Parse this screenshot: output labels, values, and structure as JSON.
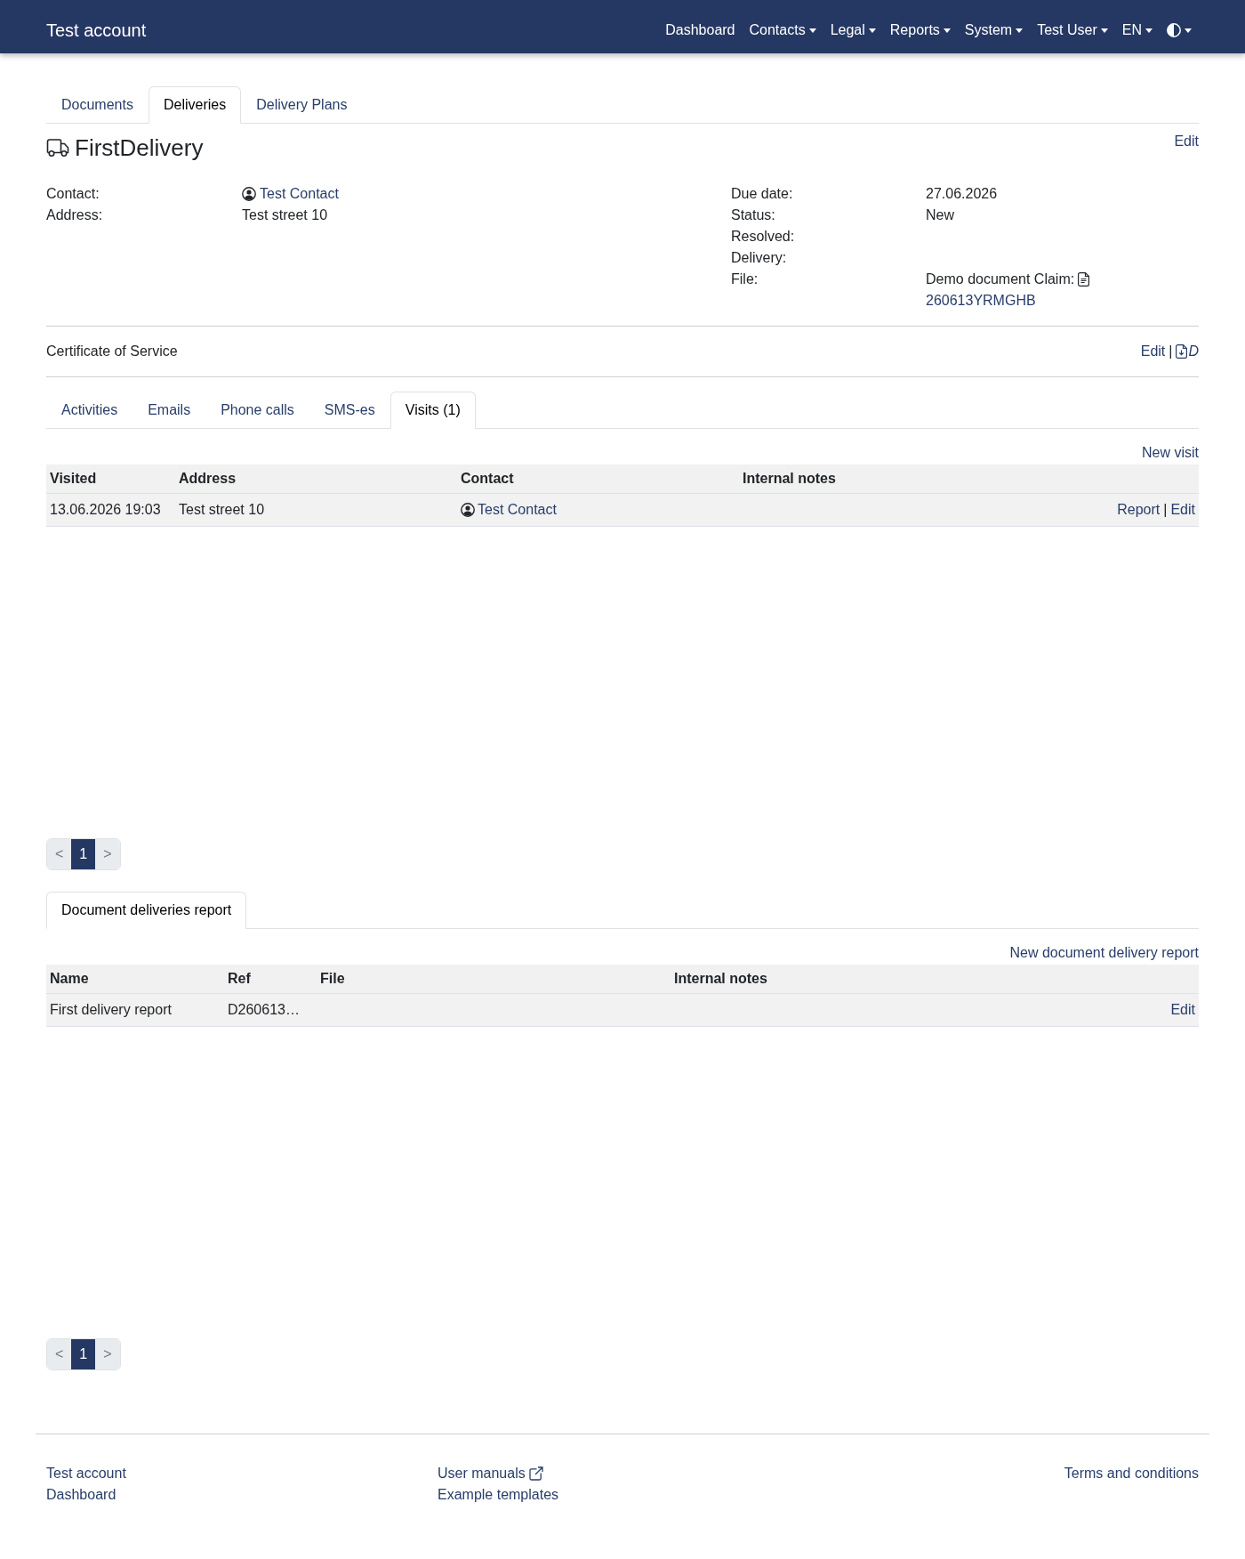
{
  "navbar": {
    "brand": "Test account",
    "items": [
      {
        "kind": "link",
        "label": "Dashboard"
      },
      {
        "kind": "menu",
        "label": "Contacts"
      },
      {
        "kind": "menu",
        "label": "Legal"
      },
      {
        "kind": "menu",
        "label": "Reports"
      },
      {
        "kind": "menu",
        "label": "System"
      },
      {
        "kind": "menu",
        "label": "Test User"
      },
      {
        "kind": "menu",
        "label": "EN"
      },
      {
        "kind": "theme"
      }
    ]
  },
  "tabs": [
    {
      "label": "Documents",
      "selected": false
    },
    {
      "label": "Deliveries",
      "selected": true
    },
    {
      "label": "Delivery Plans",
      "selected": false
    }
  ],
  "delivery": {
    "title": "FirstDelivery",
    "edit": "Edit",
    "details_left": [
      {
        "kind": "contact",
        "label": "Contact:",
        "value": "Test Contact"
      },
      {
        "kind": "text",
        "label": "Address:",
        "value": "Test street 10"
      }
    ],
    "details_right": [
      {
        "kind": "text",
        "label": "Due date:",
        "value": "27.06.2026"
      },
      {
        "kind": "text",
        "label": "Status:",
        "value": "New"
      },
      {
        "kind": "text",
        "label": "Resolved:"
      },
      {
        "kind": "text",
        "label": "Delivery:"
      },
      {
        "kind": "file",
        "label": "File:",
        "value": "Demo document Claim:",
        "link": "260613YRMGHB"
      }
    ]
  },
  "certificate": {
    "title": "Certificate of Service",
    "edit": "Edit",
    "separator": "|",
    "download": "D"
  },
  "activity_tabs": [
    {
      "label": "Activities",
      "selected": false
    },
    {
      "label": "Emails",
      "selected": false
    },
    {
      "label": "Phone calls",
      "selected": false
    },
    {
      "label": "SMS-es",
      "selected": false
    },
    {
      "label": "Visits (1)",
      "selected": true
    }
  ],
  "visits": {
    "new_link": "New visit",
    "columns": [
      "Visited",
      "Address",
      "Contact",
      "Internal notes"
    ],
    "actions_separator": "|",
    "rows": [
      {
        "visited": "13.06.2026 19:03",
        "address": "Test street 10",
        "contact": "Test Contact",
        "actions": [
          "Report",
          "Edit"
        ]
      }
    ],
    "pagination": {
      "prev": "<",
      "pages": [
        {
          "label": "1",
          "selected": true
        }
      ],
      "next": ">"
    }
  },
  "report_tabs": [
    {
      "label": "Document deliveries report",
      "selected": true
    }
  ],
  "reports": {
    "new_link": "New document delivery report",
    "columns": [
      "Name",
      "Ref",
      "File",
      "Internal notes"
    ],
    "rows": [
      {
        "name": "First delivery report",
        "ref": "D260613…",
        "actions": [
          "Edit"
        ]
      }
    ],
    "pagination": {
      "prev": "<",
      "pages": [
        {
          "label": "1",
          "selected": true
        }
      ],
      "next": ">"
    }
  },
  "footer": {
    "left": [
      {
        "label": "Test account",
        "external": false
      },
      {
        "label": "Dashboard",
        "external": false
      }
    ],
    "middle": [
      {
        "label": "User manuals",
        "external": true
      },
      {
        "label": "Example templates",
        "external": false
      }
    ],
    "right": [
      {
        "label": "Terms and conditions",
        "external": false
      }
    ]
  }
}
